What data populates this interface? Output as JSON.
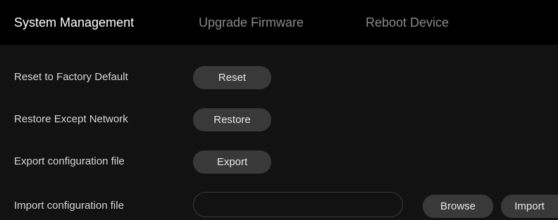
{
  "tabs": [
    {
      "label": "System Management",
      "active": true
    },
    {
      "label": "Upgrade Firmware",
      "active": false
    },
    {
      "label": "Reboot Device",
      "active": false
    }
  ],
  "rows": {
    "reset": {
      "label": "Reset to Factory Default",
      "button": "Reset"
    },
    "restore": {
      "label": "Restore Except Network",
      "button": "Restore"
    },
    "export": {
      "label": "Export configuration file",
      "button": "Export"
    },
    "import": {
      "label": "Import configuration file",
      "file_value": "",
      "browse_button": "Browse",
      "import_button": "Import"
    }
  },
  "colors": {
    "background": "#000000",
    "panel": "#121212",
    "button": "#393939",
    "active_tab": "#ffffff",
    "inactive_tab": "#8a8a8a"
  }
}
